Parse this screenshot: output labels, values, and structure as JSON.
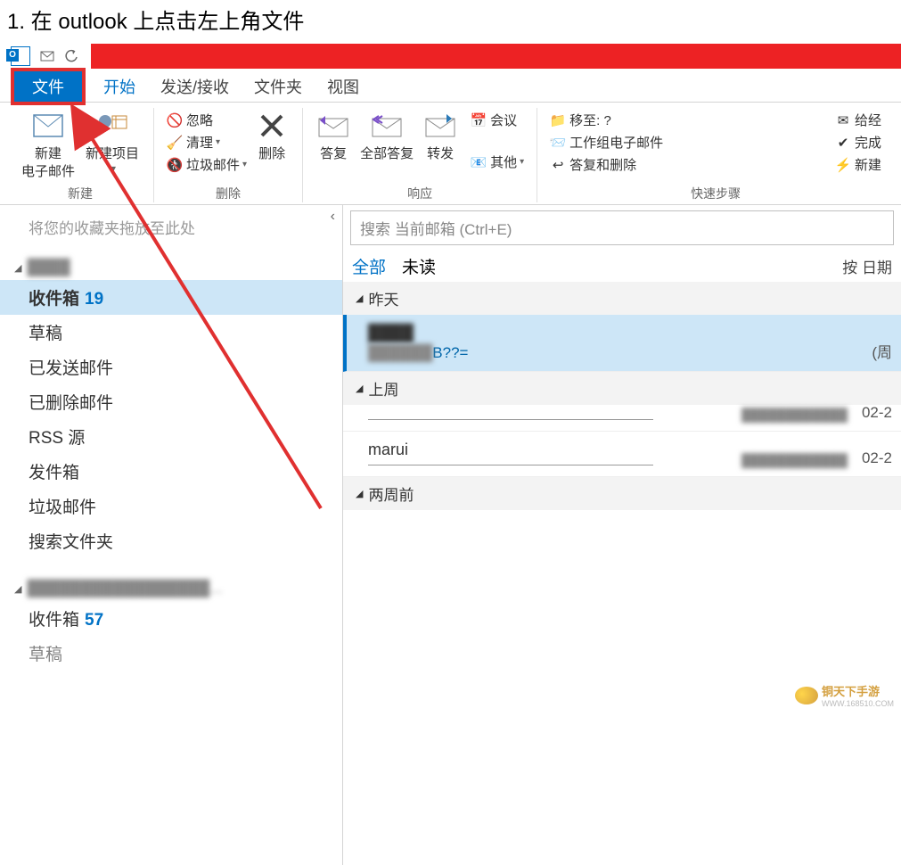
{
  "instruction": "1. 在 outlook 上点击左上角文件",
  "tabs": {
    "file": "文件",
    "start": "开始",
    "sendrecv": "发送/接收",
    "folder": "文件夹",
    "view": "视图"
  },
  "ribbon": {
    "new_group": "新建",
    "new_email": "新建\n电子邮件",
    "new_item": "新建项目",
    "delete_group": "删除",
    "ignore": "忽略",
    "cleanup": "清理",
    "junk": "垃圾邮件",
    "delete": "删除",
    "respond_group": "响应",
    "reply": "答复",
    "reply_all": "全部答复",
    "forward": "转发",
    "meeting": "会议",
    "other": "其他",
    "quick_group": "快速步骤",
    "move_to": "移至: ?",
    "team_mail": "工作组电子邮件",
    "reply_delete": "答复和删除",
    "to_boss": "给经",
    "done": "完成",
    "new_quick": "新建"
  },
  "nav": {
    "fav_hint": "将您的收藏夹拖放至此处",
    "folders": [
      {
        "name": "收件箱",
        "count": "19",
        "sel": true
      },
      {
        "name": "草稿"
      },
      {
        "name": "已发送邮件"
      },
      {
        "name": "已删除邮件"
      },
      {
        "name": "RSS 源"
      },
      {
        "name": "发件箱"
      },
      {
        "name": "垃圾邮件"
      },
      {
        "name": "搜索文件夹"
      }
    ],
    "inbox2": {
      "name": "收件箱",
      "count": "57"
    },
    "drafts2": "草稿"
  },
  "list": {
    "search_placeholder": "搜索 当前邮箱 (Ctrl+E)",
    "filter_all": "全部",
    "filter_unread": "未读",
    "sort_by": "按 日期",
    "grp_yesterday": "昨天",
    "grp_lastweek": "上周",
    "grp_twoweeks": "两周前",
    "item1_subj": "B??=",
    "item1_date": "(周",
    "item2_from": "",
    "item2_date": "02-2",
    "item3_from": "marui",
    "item3_date": "02-2"
  },
  "watermark": {
    "text": "铜天下手游",
    "url": "WWW.168510.COM"
  }
}
